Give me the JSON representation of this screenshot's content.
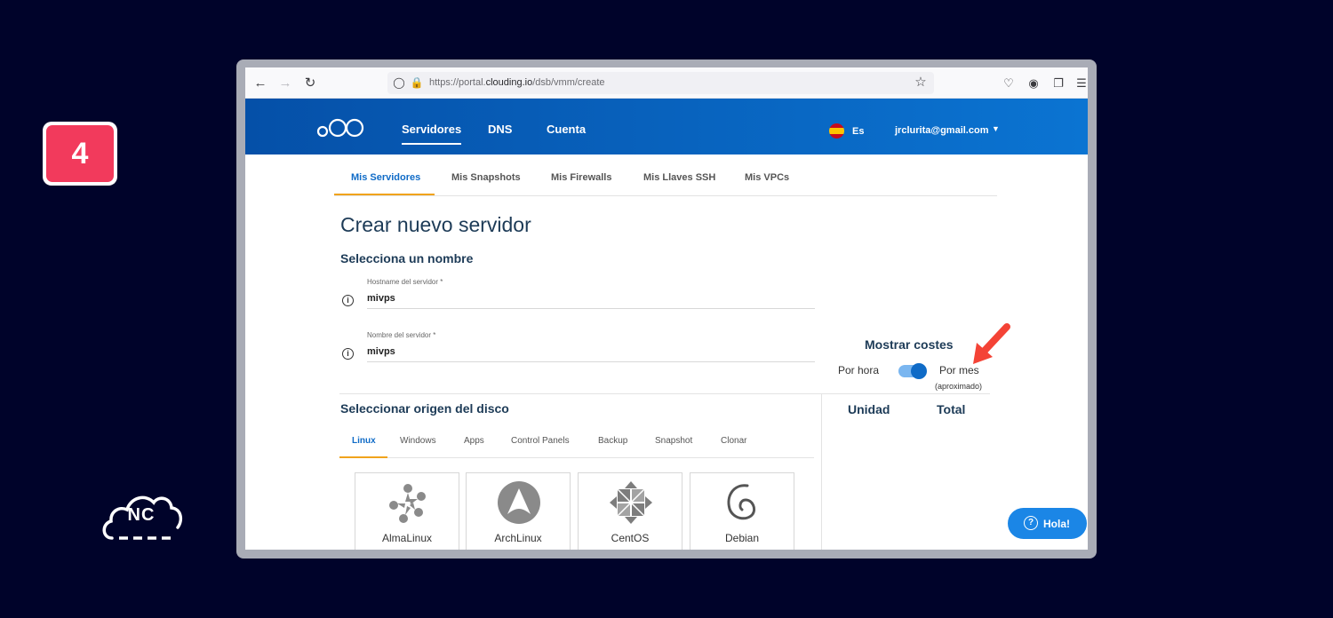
{
  "step": {
    "number": "4"
  },
  "brand": {
    "nc_label": "NC"
  },
  "browser": {
    "url_prefix": "https://portal.",
    "url_domain": "clouding.io",
    "url_path": "/dsb/vmm/create"
  },
  "header": {
    "nav": [
      "Servidores",
      "DNS",
      "Cuenta"
    ],
    "language": "Es",
    "user_email": "jrclurita@gmail.com"
  },
  "subtabs": [
    "Mis Servidores",
    "Mis Snapshots",
    "Mis Firewalls",
    "Mis Llaves SSH",
    "Mis VPCs"
  ],
  "page": {
    "title": "Crear nuevo servidor",
    "name_section": "Selecciona un nombre",
    "hostname_label": "Hostname del servidor *",
    "hostname_value": "mivps",
    "servername_label": "Nombre del servidor *",
    "servername_value": "mivps"
  },
  "costs": {
    "title": "Mostrar costes",
    "per_hour": "Por hora",
    "per_month": "Por mes",
    "approx": "(aproximado)",
    "toggle_on": true,
    "col_unit": "Unidad",
    "col_total": "Total"
  },
  "disk": {
    "title": "Seleccionar origen del disco",
    "tabs": [
      "Linux",
      "Windows",
      "Apps",
      "Control Panels",
      "Backup",
      "Snapshot",
      "Clonar"
    ],
    "os": [
      "AlmaLinux",
      "ArchLinux",
      "CentOS",
      "Debian"
    ]
  },
  "chat": {
    "label": "Hola!"
  },
  "colors": {
    "accent": "#0f6bc7",
    "tab_underline": "#f0a31c",
    "badge": "#f23a5c",
    "arrow": "#f44336"
  }
}
